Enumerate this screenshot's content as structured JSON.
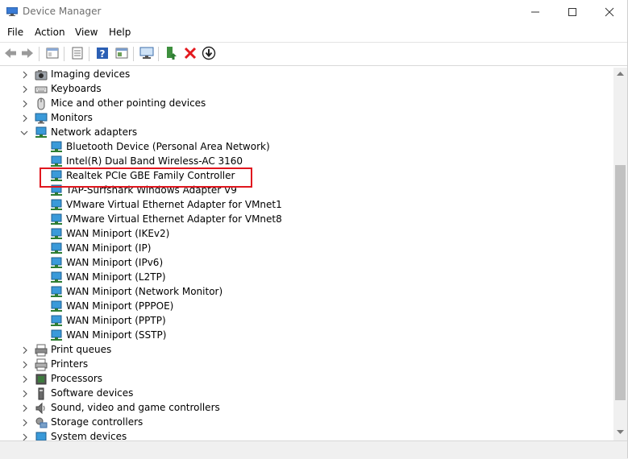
{
  "window": {
    "title": "Device Manager",
    "minimize_icon": "minimize-icon",
    "maximize_icon": "maximize-icon",
    "close_icon": "close-icon"
  },
  "menu": {
    "items": [
      "File",
      "Action",
      "View",
      "Help"
    ]
  },
  "toolbar": {
    "icons": [
      "back-arrow-icon",
      "forward-arrow-icon",
      "properties-window-icon",
      "device-list-icon",
      "help-icon",
      "view-icon",
      "monitor-scan-icon",
      "update-driver-icon",
      "uninstall-x-icon",
      "download-circle-icon"
    ]
  },
  "colors": {
    "highlight_box": "#e0161e",
    "uninstall": "#e3191e",
    "help": "#2b5fb4"
  },
  "tree": {
    "imaging": "Imaging devices",
    "keyboards": "Keyboards",
    "mice": "Mice and other pointing devices",
    "monitors": "Monitors",
    "network": "Network adapters",
    "adapters": [
      "Bluetooth Device (Personal Area Network)",
      "Intel(R) Dual Band Wireless-AC 3160",
      "Realtek PCIe GBE Family Controller",
      "TAP-Surfshark Windows Adapter V9",
      "VMware Virtual Ethernet Adapter for VMnet1",
      "VMware Virtual Ethernet Adapter for VMnet8",
      "WAN Miniport (IKEv2)",
      "WAN Miniport (IP)",
      "WAN Miniport (IPv6)",
      "WAN Miniport (L2TP)",
      "WAN Miniport (Network Monitor)",
      "WAN Miniport (PPPOE)",
      "WAN Miniport (PPTP)",
      "WAN Miniport (SSTP)"
    ],
    "print_queues": "Print queues",
    "printers": "Printers",
    "processors": "Processors",
    "software": "Software devices",
    "sound": "Sound, video and game controllers",
    "storage": "Storage controllers",
    "system": "System devices"
  }
}
